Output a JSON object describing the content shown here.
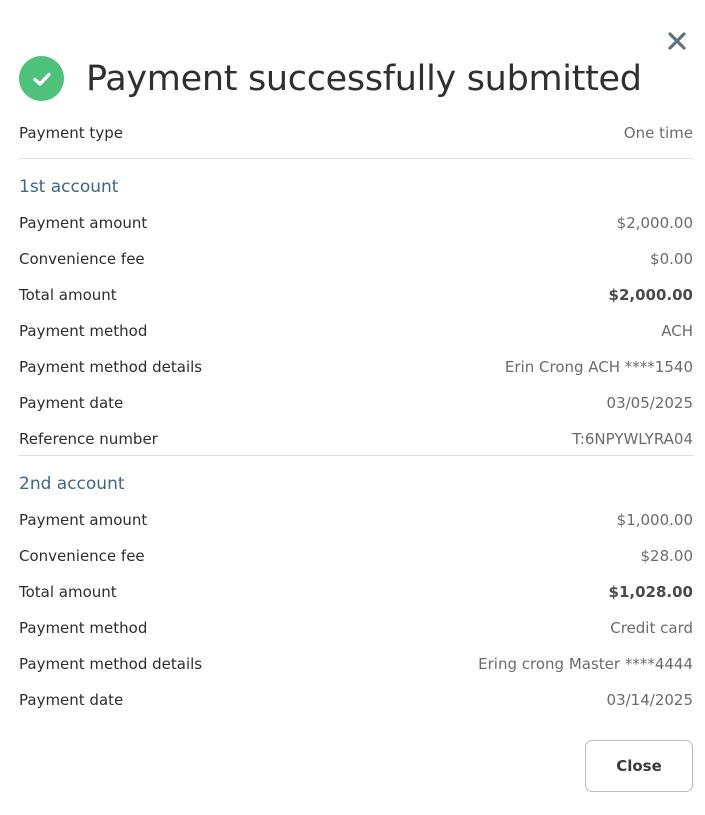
{
  "dialog": {
    "title": "Payment successfully submitted",
    "close_icon": "close-icon",
    "status_icon": "check-circle-icon",
    "status_color": "#4ec27a",
    "close_label": "Close"
  },
  "payment_type": {
    "label": "Payment type",
    "value": "One time"
  },
  "accounts": [
    {
      "heading": "1st account",
      "rows": [
        {
          "label": "Payment amount",
          "value": "$2,000.00"
        },
        {
          "label": "Convenience fee",
          "value": "$0.00"
        },
        {
          "label": "Total amount",
          "value": "$2,000.00"
        },
        {
          "label": "Payment method",
          "value": "ACH"
        },
        {
          "label": "Payment method details",
          "value": "Erin Crong ACH ****1540"
        },
        {
          "label": "Payment date",
          "value": "03/05/2025"
        },
        {
          "label": "Reference number",
          "value": "T:6NPYWLYRA04"
        }
      ]
    },
    {
      "heading": "2nd account",
      "rows": [
        {
          "label": "Payment amount",
          "value": "$1,000.00"
        },
        {
          "label": "Convenience fee",
          "value": "$28.00"
        },
        {
          "label": "Total amount",
          "value": "$1,028.00"
        },
        {
          "label": "Payment method",
          "value": "Credit card"
        },
        {
          "label": "Payment method details",
          "value": "Ering crong Master ****4444"
        },
        {
          "label": "Payment date",
          "value": "03/14/2025"
        }
      ]
    }
  ]
}
